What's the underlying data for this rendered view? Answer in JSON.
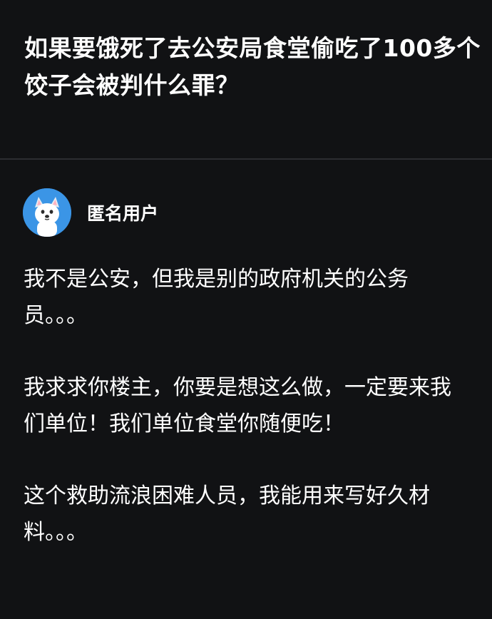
{
  "question": {
    "title": "如果要饿死了去公安局食堂偷吃了100多个饺子会被判什么罪？"
  },
  "answer": {
    "author": {
      "name": "匿名用户",
      "avatar_icon": "anonymous-dog-avatar"
    },
    "paragraphs": [
      "我不是公安，但我是别的政府机关的公务员。。。",
      "我求求你楼主，你要是想这么做，一定要来我们单位！我们单位食堂你随便吃！",
      "这个救助流浪困难人员，我能用来写好久材料。。。"
    ]
  },
  "colors": {
    "background": "#111214",
    "text": "#ffffff",
    "divider": "#2c2d31",
    "avatar": "#3b95e6"
  }
}
